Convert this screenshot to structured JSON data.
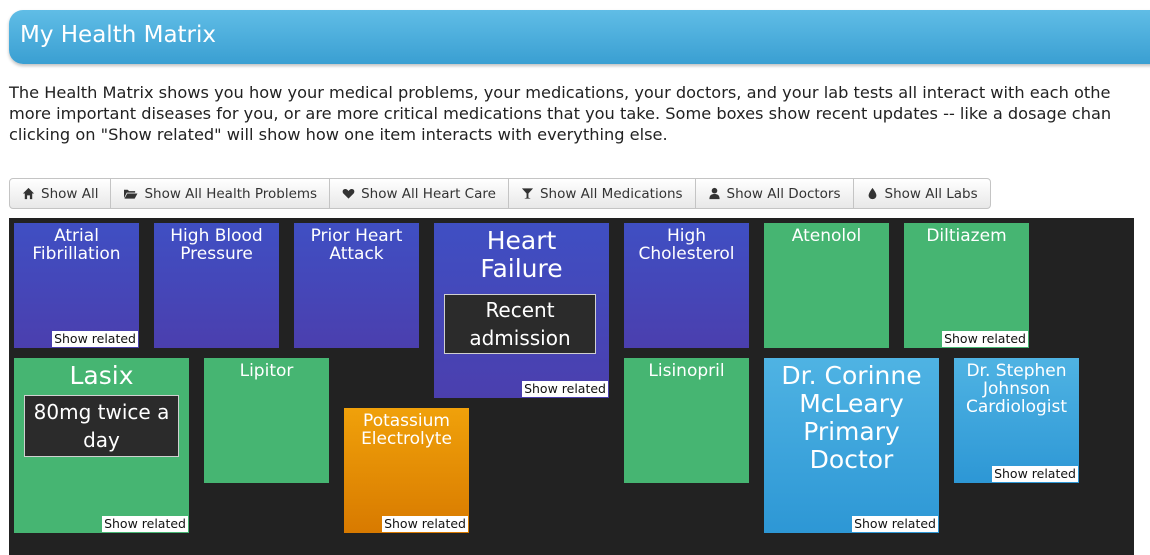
{
  "header": {
    "title": "My Health Matrix"
  },
  "intro": {
    "line1": "The Health Matrix shows you how your medical problems, your medications, your doctors, and your lab tests all interact with each othe",
    "line2": "more important diseases for you, or are more critical medications that you take. Some boxes show recent updates -- like a dosage chan",
    "line3": "clicking on \"Show related\" will show how one item interacts with everything else."
  },
  "toolbar": {
    "show_all": "Show All",
    "show_problems": "Show All Health Problems",
    "show_heart": "Show All Heart Care",
    "show_meds": "Show All Medications",
    "show_doctors": "Show All Doctors",
    "show_labs": "Show All Labs"
  },
  "tiles": {
    "atrial_fibrillation": {
      "title": "Atrial Fibrillation",
      "link": "Show related"
    },
    "high_blood_pressure": {
      "title": "High Blood Pressure"
    },
    "prior_heart_attack": {
      "title": "Prior Heart Attack"
    },
    "heart_failure": {
      "title": "Heart Failure",
      "note": "Recent admission",
      "link": "Show related"
    },
    "high_cholesterol": {
      "title": "High Cholesterol"
    },
    "atenolol": {
      "title": "Atenolol"
    },
    "diltiazem": {
      "title": "Diltiazem",
      "link": "Show related"
    },
    "lasix": {
      "title": "Lasix",
      "note": "80mg twice a day",
      "link": "Show related"
    },
    "lipitor": {
      "title": "Lipitor"
    },
    "potassium": {
      "title": "Potassium Electrolyte",
      "link": "Show related"
    },
    "lisinopril": {
      "title": "Lisinopril"
    },
    "dr_mcleary": {
      "title": "Dr. Corinne McLeary Primary Doctor",
      "link": "Show related"
    },
    "dr_johnson": {
      "title": "Dr. Stephen Johnson Cardiologist",
      "link": "Show related"
    }
  },
  "colors": {
    "problem": "#4a45b8",
    "medication": "#46b572",
    "lab": "#e8900a",
    "doctor": "#3aa5dc",
    "header": "#4aaedc"
  }
}
